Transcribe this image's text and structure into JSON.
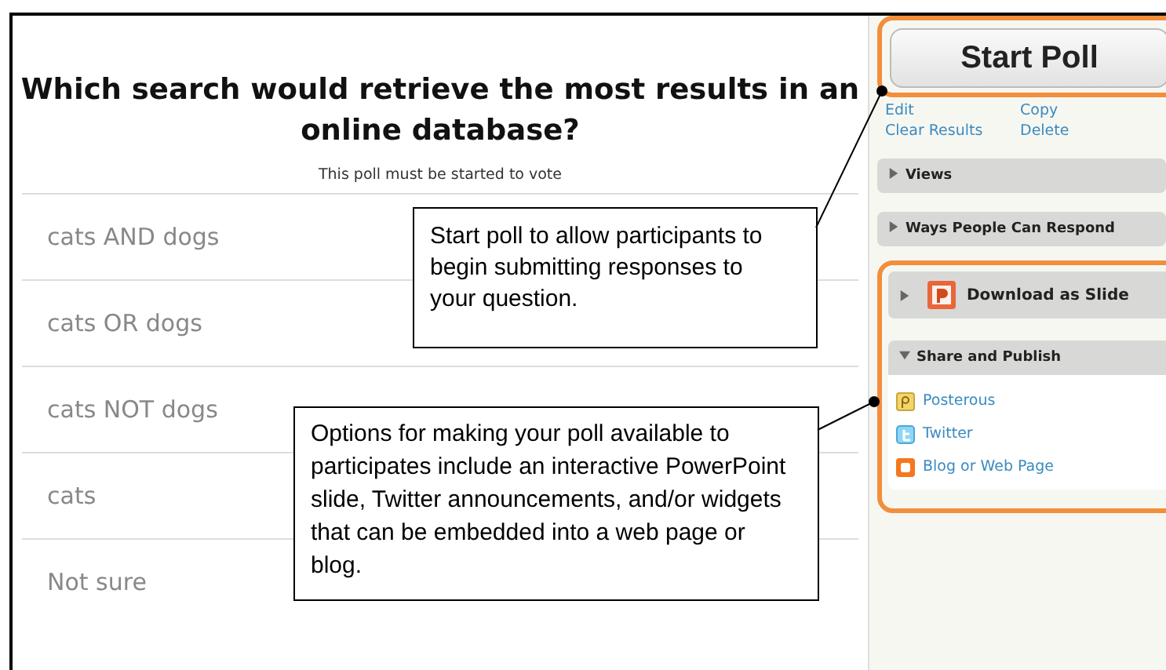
{
  "poll": {
    "question": "Which search would retrieve the most results in an online database?",
    "status": "This poll must be started to vote",
    "options": [
      "cats AND dogs",
      "cats OR dogs",
      "cats NOT dogs",
      "cats",
      "Not sure"
    ]
  },
  "sidebar": {
    "start_button": "Start Poll",
    "links": [
      "Edit",
      "Copy",
      "Clear Results",
      "Delete"
    ],
    "panels": [
      {
        "title": "Views",
        "expanded": false
      },
      {
        "title": "Ways People Can Respond",
        "expanded": false
      }
    ],
    "download": {
      "title": "Download as Slide",
      "expanded": false
    },
    "share": {
      "title": "Share and Publish",
      "expanded": true,
      "items": [
        {
          "kind": "posterous",
          "label": "Posterous"
        },
        {
          "kind": "twitter",
          "label": "Twitter"
        },
        {
          "kind": "blog",
          "label": "Blog or Web Page"
        }
      ]
    }
  },
  "callouts": [
    "Start poll to allow participants to begin submitting responses to your question.",
    "Options for making your poll available to participates include an interactive PowerPoint slide, Twitter announcements, and/or widgets that can be embedded into a web page or blog."
  ]
}
